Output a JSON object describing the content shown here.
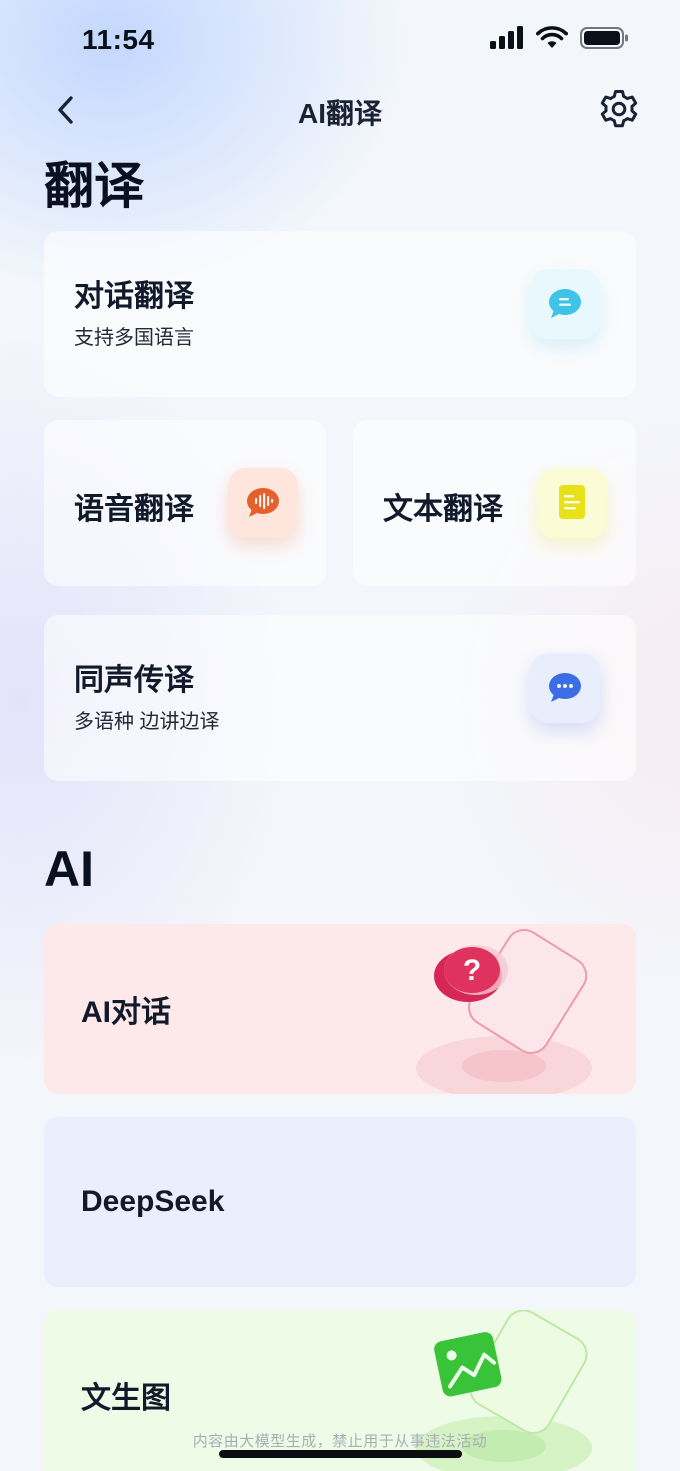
{
  "status_bar": {
    "time": "11:54"
  },
  "nav": {
    "title": "AI翻译"
  },
  "sections": {
    "translate_title": "翻译",
    "ai_title": "AI"
  },
  "translate_cards": {
    "dialog": {
      "title": "对话翻译",
      "subtitle": "支持多国语言",
      "icon": "chat-bubble-icon",
      "color": "#3fc3e6"
    },
    "voice": {
      "title": "语音翻译",
      "icon": "voice-bubble-icon",
      "color": "#e5602c"
    },
    "text": {
      "title": "文本翻译",
      "icon": "document-icon",
      "color": "#e8e018"
    },
    "simul": {
      "title": "同声传译",
      "subtitle": "多语种 边讲边译",
      "icon": "speech-dots-icon",
      "color": "#3b6ee6"
    }
  },
  "ai_cards": {
    "chat": {
      "title": "AI对话",
      "icon": "question-bubble-icon",
      "color": "#e0325e",
      "symbol": "?"
    },
    "deepseek": {
      "title": "DeepSeek"
    },
    "text_to_image": {
      "title": "文生图",
      "icon": "image-icon",
      "color": "#39c339"
    }
  },
  "footer": {
    "disclaimer": "内容由大模型生成，禁止用于从事违法活动"
  }
}
